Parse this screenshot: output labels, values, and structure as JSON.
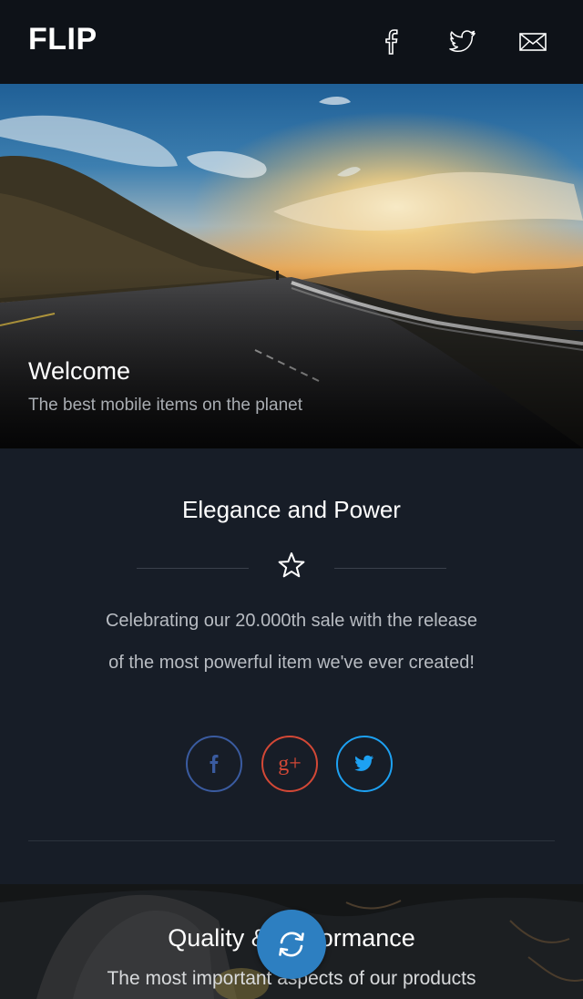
{
  "header": {
    "logo": "FLIP",
    "icons": [
      "facebook-icon",
      "twitter-icon",
      "mail-icon"
    ]
  },
  "hero": {
    "title": "Welcome",
    "subtitle": "The best mobile items on the planet"
  },
  "elegance": {
    "title": "Elegance and Power",
    "divider_icon": "star-icon",
    "text_line1": "Celebrating our 20.000th sale with the release",
    "text_line2": "of the most powerful item we've ever created!",
    "social": [
      {
        "name": "facebook",
        "label": "f",
        "color": "#3a5ba0"
      },
      {
        "name": "google-plus",
        "label": "g+",
        "color": "#d34836"
      },
      {
        "name": "twitter",
        "label": "",
        "color": "#1da1f2"
      }
    ]
  },
  "quality": {
    "title": "Quality & Performance",
    "subtitle": "The most important aspects of our products"
  },
  "fab": {
    "icon": "refresh-icon",
    "color": "#2d7fc1"
  }
}
